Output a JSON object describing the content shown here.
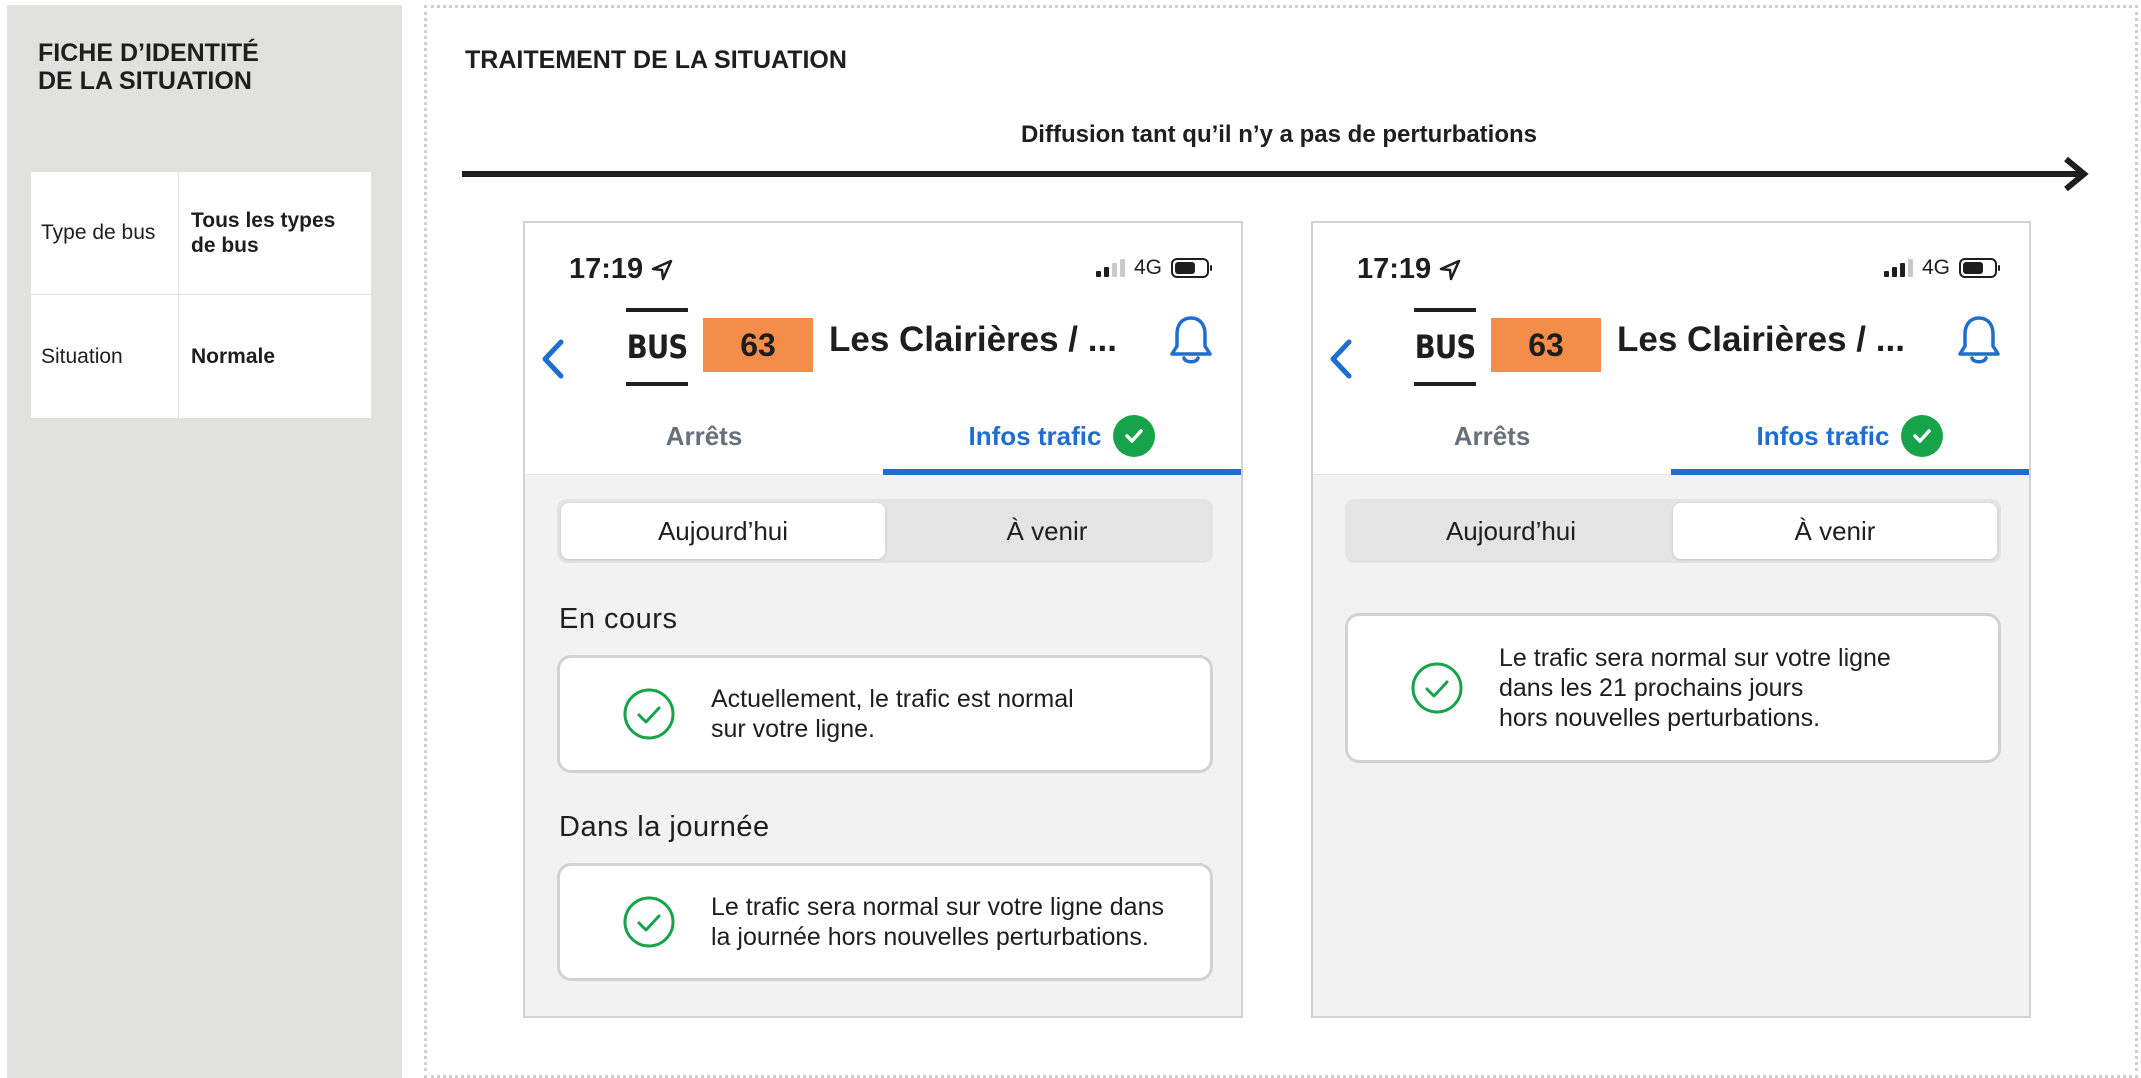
{
  "identity_panel": {
    "title_line1": "FICHE D’IDENTITÉ",
    "title_line2": "DE LA SITUATION",
    "rows": [
      {
        "label": "Type de bus",
        "value": "Tous les types de bus"
      },
      {
        "label": "Situation",
        "value": "Normale"
      }
    ]
  },
  "main": {
    "title": "TRAITEMENT DE LA SITUATION",
    "timeline_caption": "Diffusion tant qu’il n’y a pas de perturbations"
  },
  "phones": [
    {
      "status": {
        "time": "17:19",
        "network": "4G"
      },
      "header": {
        "mode": "BUS",
        "line_number": "63",
        "line_name": "Les Clairières / ..."
      },
      "tabs": [
        "Arrêts",
        "Infos trafic"
      ],
      "active_tab": "Infos trafic",
      "segments": [
        "Aujourd’hui",
        "À venir"
      ],
      "selected_segment": "Aujourd’hui",
      "sections": [
        {
          "heading": "En cours",
          "lines": [
            "Actuellement, le trafic est normal",
            "sur votre ligne."
          ]
        },
        {
          "heading": "Dans la journée",
          "lines": [
            "Le trafic sera normal sur votre ligne dans",
            "la journée hors nouvelles perturbations."
          ]
        }
      ]
    },
    {
      "status": {
        "time": "17:19",
        "network": "4G"
      },
      "header": {
        "mode": "BUS",
        "line_number": "63",
        "line_name": "Les Clairières / ..."
      },
      "tabs": [
        "Arrêts",
        "Infos trafic"
      ],
      "active_tab": "Infos trafic",
      "segments": [
        "Aujourd’hui",
        "À venir"
      ],
      "selected_segment": "À venir",
      "sections": [
        {
          "heading": "",
          "lines": [
            "Le trafic sera normal sur votre ligne",
            "dans les 21 prochains jours",
            "hors nouvelles perturbations."
          ]
        }
      ]
    }
  ],
  "colors": {
    "accent_blue": "#1f6dcf",
    "line_orange": "#f58d4a",
    "success_green": "#16a34a",
    "panel_grey": "#e1e1df"
  },
  "icons": [
    "navigation-arrow-icon",
    "signal-icon",
    "battery-icon",
    "back-chevron-icon",
    "bell-icon",
    "check-badge-icon",
    "check-circle-icon",
    "timeline-arrow-icon"
  ]
}
